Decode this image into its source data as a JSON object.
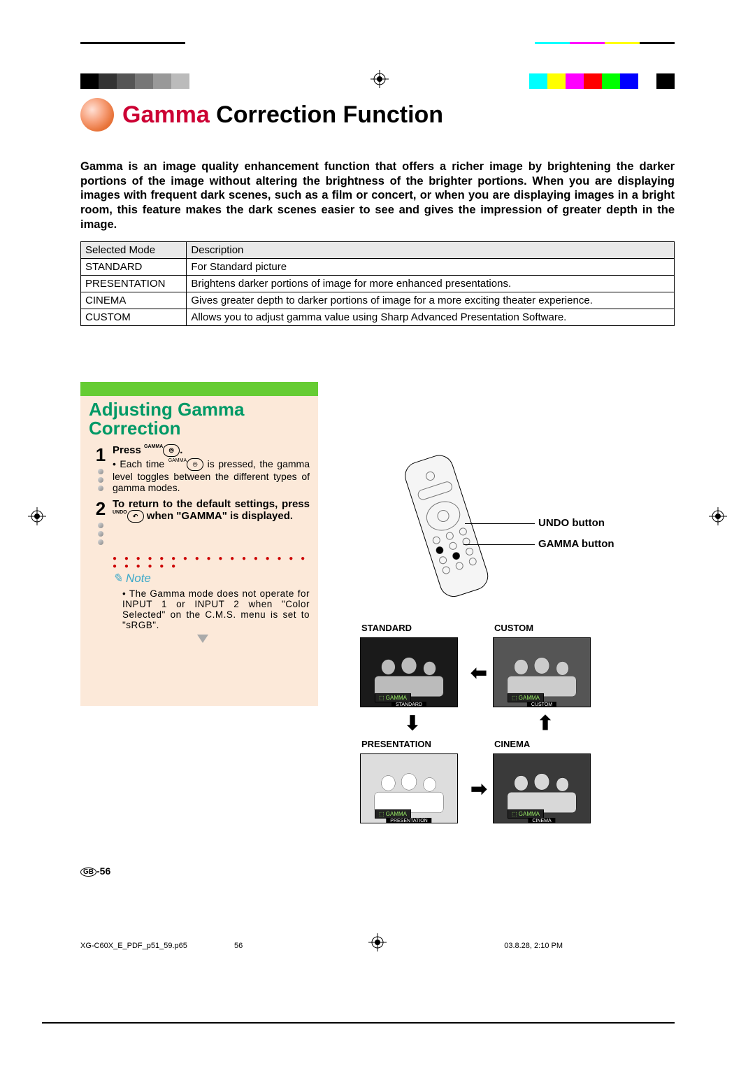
{
  "title_accent": "Gamma",
  "title_rest": " Correction Function",
  "intro": "Gamma is an image quality enhancement function that offers a richer image by brightening the darker portions of the image without altering the brightness of the brighter portions. When you are displaying images with frequent dark scenes, such as a film or concert, or when you are displaying images in a bright room, this feature makes the dark scenes easier to see and gives the impression of greater depth in the image.",
  "table": {
    "headers": [
      "Selected Mode",
      "Description"
    ],
    "rows": [
      [
        "STANDARD",
        "For Standard picture"
      ],
      [
        "PRESENTATION",
        "Brightens darker portions of image for more enhanced presentations."
      ],
      [
        "CINEMA",
        "Gives greater depth to darker portions of image for a more exciting theater experience."
      ],
      [
        "CUSTOM",
        "Allows you to adjust gamma value using Sharp Advanced Presentation Software."
      ]
    ]
  },
  "section_title": "Adjusting Gamma Correction",
  "steps": {
    "1": {
      "num": "1",
      "head_pre": "Press ",
      "head_post": ".",
      "icon_top": "GAMMA",
      "body_pre": "• Each time ",
      "body_post": " is pressed, the gamma level toggles between the different types of gamma modes."
    },
    "2": {
      "num": "2",
      "head_pre": "To return to the default settings, press ",
      "head_mid": " when \"GAMMA\" is displayed.",
      "icon_top": "UNDO"
    }
  },
  "note_label": "Note",
  "note_body": "• The Gamma mode does not operate for INPUT 1 or INPUT 2 when \"Color Selected\" on the C.M.S. menu is set to \"sRGB\".",
  "callouts": {
    "undo": "UNDO button",
    "gamma": "GAMMA button"
  },
  "modes": {
    "standard": "STANDARD",
    "custom": "CUSTOM",
    "presentation": "PRESENTATION",
    "cinema": "CINEMA",
    "badge": "GAMMA"
  },
  "mode_sub": {
    "standard": "STANDARD",
    "custom": "CUSTOM",
    "presentation": "PRESENTATION",
    "cinema": "CINEMA"
  },
  "footer": {
    "gb": "GB",
    "page": "-56",
    "file": "XG-C60X_E_PDF_p51_59.p65",
    "sheet": "56",
    "timestamp": "03.8.28, 2:10 PM"
  }
}
